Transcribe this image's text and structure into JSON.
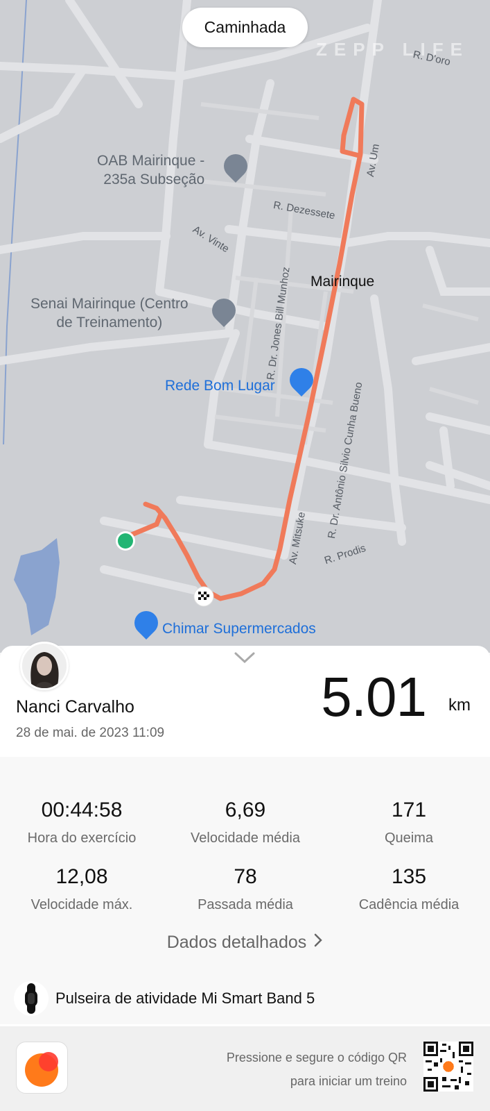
{
  "map": {
    "activity_type": "Caminhada",
    "watermark": "ZEPP LIFE",
    "pois": {
      "oab": "OAB Mairinque -\n235a Subseção",
      "senai": "Senai Mairinque (Centro\nde Treinamento)",
      "rede": "Rede Bom Lugar",
      "chimar": "Chimar Supermercados",
      "city": "Mairinque"
    },
    "streets": {
      "doro": "R. D'oro",
      "dezessete": "R. Dezessete",
      "vinte": "Av. Vinte",
      "um": "Av. Um",
      "jones": "R. Dr. Jones Bill Munhoz",
      "silvio": "R. Dr. Antônio Silvio Cunha Bueno",
      "mitsuke": "Av. Mitsuke",
      "prodis": "R. Prodis"
    }
  },
  "summary": {
    "user_name": "Nanci Carvalho",
    "date": "28 de mai. de 2023 11:09",
    "distance_value": "5.01",
    "distance_unit": "km"
  },
  "stats": [
    {
      "value": "00:44:58",
      "label": "Hora do exercício"
    },
    {
      "value": "6,69",
      "label": "Velocidade média"
    },
    {
      "value": "171",
      "label": "Queima"
    },
    {
      "value": "12,08",
      "label": "Velocidade máx."
    },
    {
      "value": "78",
      "label": "Passada média"
    },
    {
      "value": "135",
      "label": "Cadência média"
    }
  ],
  "details_link": "Dados detalhados",
  "device": {
    "name": "Pulseira de atividade Mi Smart Band 5"
  },
  "footer": {
    "qr_hint_line1": "Pressione e segure o código QR",
    "qr_hint_line2": "para iniciar um treino"
  },
  "colors": {
    "route": "#f07a5a",
    "start": "#22b573",
    "poi_blue": "#1e6fd9"
  }
}
